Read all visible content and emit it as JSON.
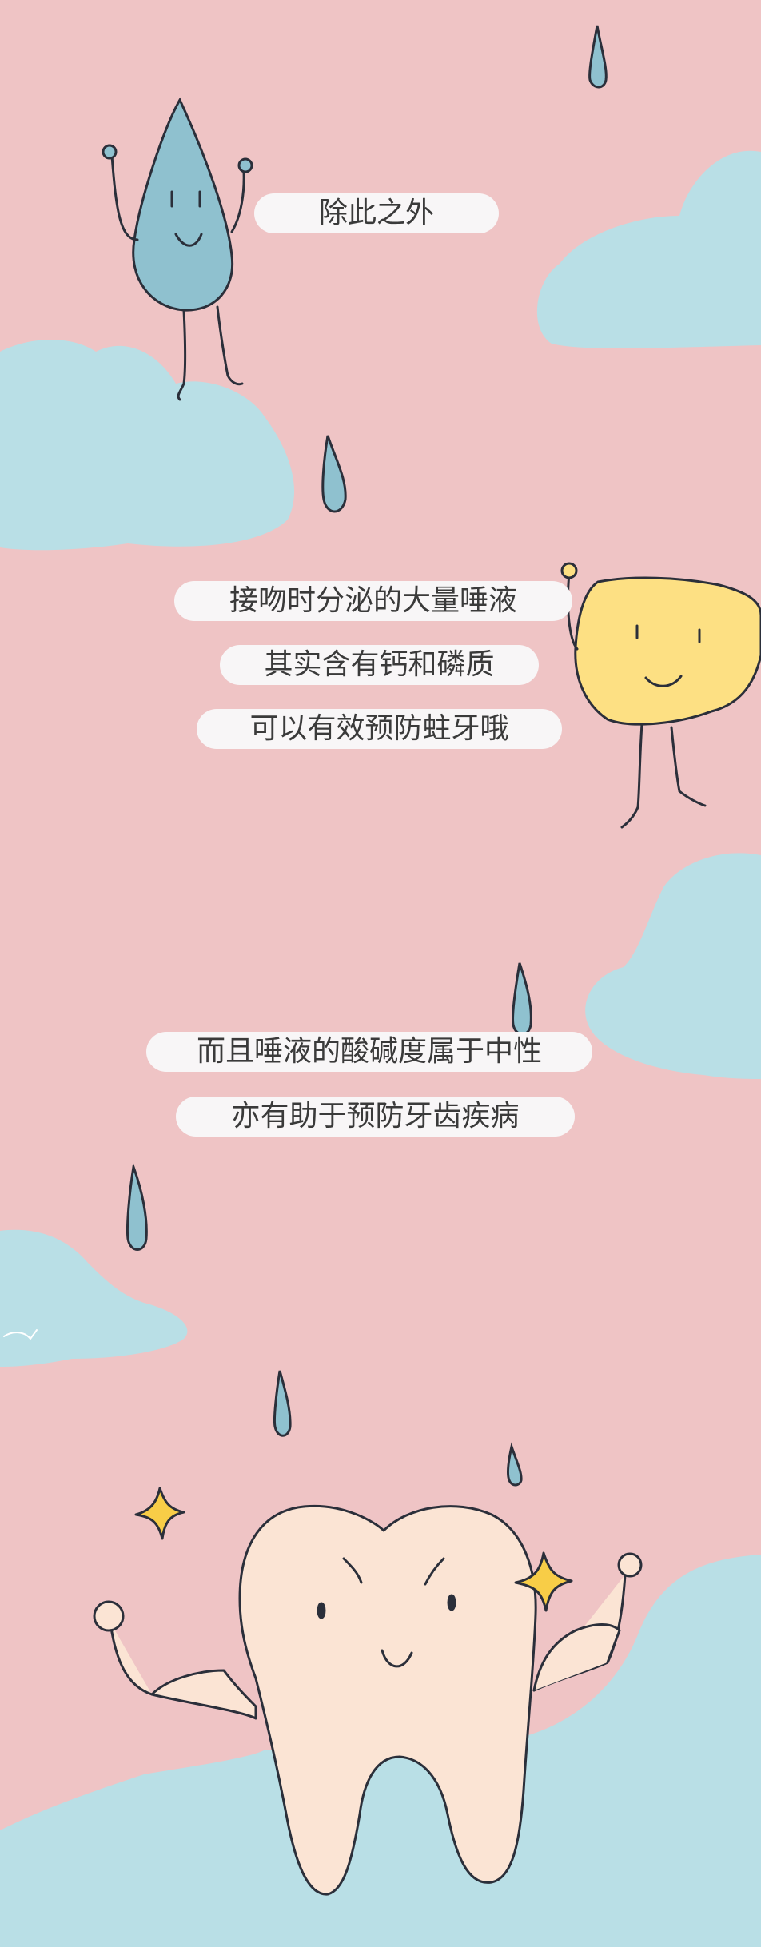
{
  "colors": {
    "background": "#efc4c5",
    "cloud": "#b9dfe6",
    "raindrop": "#8fc1cf",
    "outline": "#2b2f3a",
    "pill": "#f8f6f7",
    "pill_text": "#3a3a3a",
    "saliva_blob": "#fde083",
    "tooth": "#fbe4d4",
    "sparkle": "#f8cd47"
  },
  "characters": {
    "droplet": "smiling-water-drop-icon",
    "saliva": "smiling-yellow-blob-icon",
    "tooth": "flexing-tooth-icon"
  },
  "captions": {
    "intro": "除此之外",
    "saliva_lines": [
      "接吻时分泌的大量唾液",
      "其实含有钙和磷质",
      "可以有效预防蛀牙哦"
    ],
    "ph_lines": [
      "而且唾液的酸碱度属于中性",
      "亦有助于预防牙齿疾病"
    ]
  }
}
